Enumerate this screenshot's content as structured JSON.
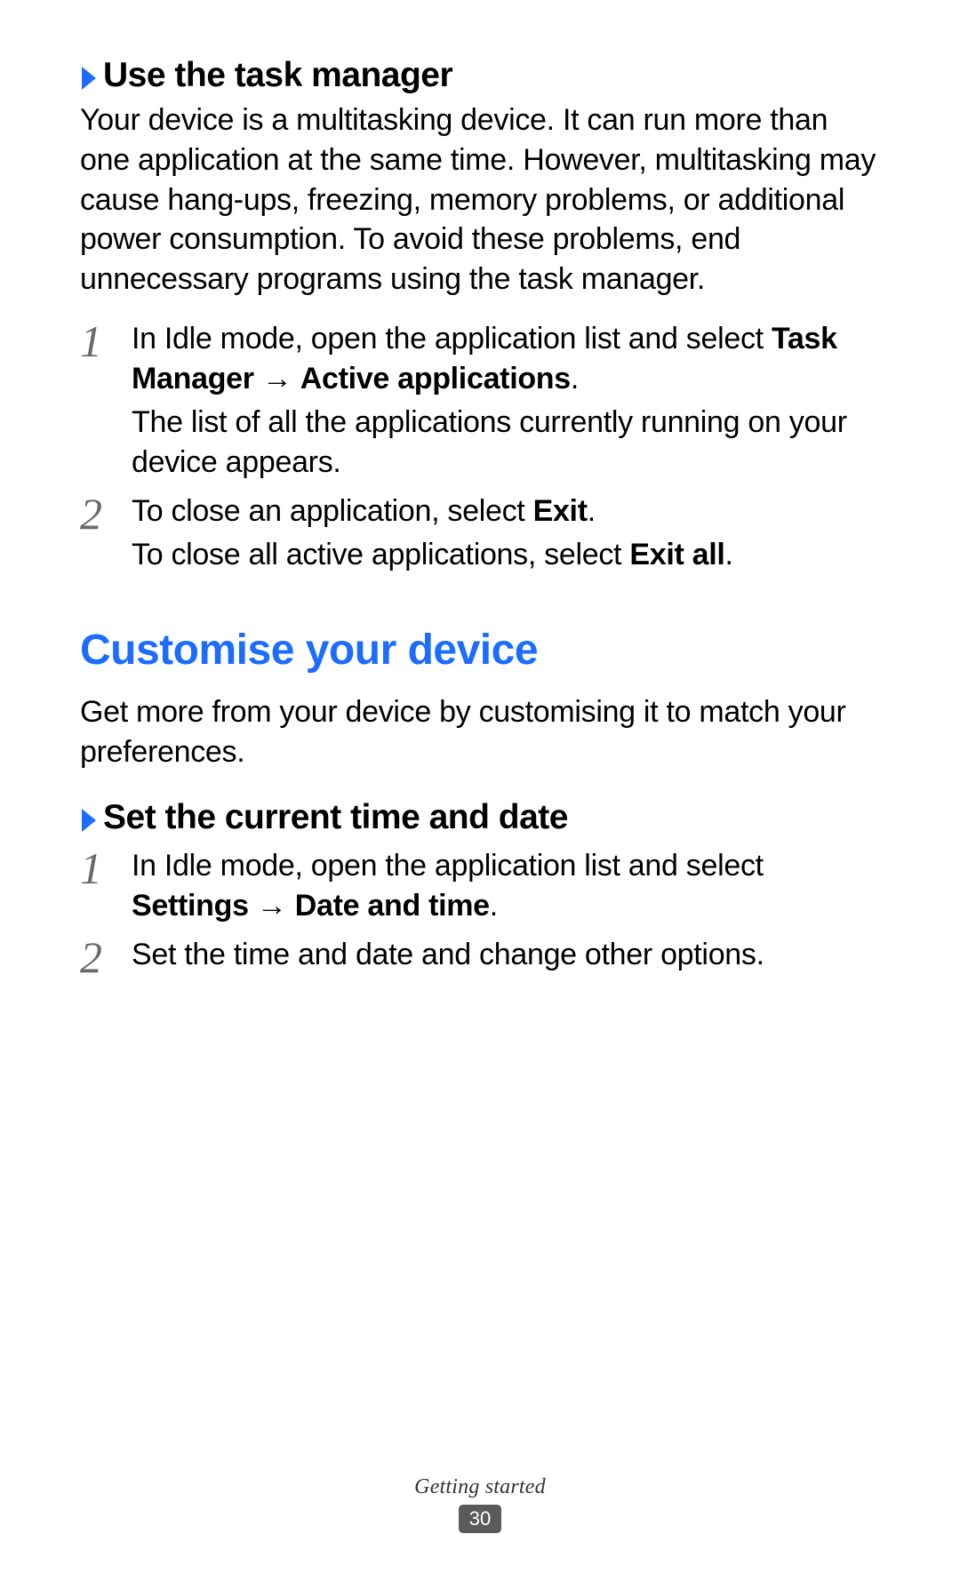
{
  "section1": {
    "heading": "Use the task manager",
    "intro": "Your device is a multitasking device. It can run more than one application at the same time. However, multitasking may cause hang-ups, freezing, memory problems, or additional power consumption. To avoid these problems, end unnecessary programs using the task manager.",
    "step1": {
      "num": "1",
      "pre": "In Idle mode, open the application list and select ",
      "b1": "Task Manager",
      "arrow": " → ",
      "b2": "Active applications",
      "post": ".",
      "line2": "The list of all the applications currently running on your device appears."
    },
    "step2": {
      "num": "2",
      "pre": "To close an application, select ",
      "b1": "Exit",
      "post1": ".",
      "line2pre": "To close all active applications, select ",
      "b2": "Exit all",
      "post2": "."
    }
  },
  "section2": {
    "title": "Customise your device",
    "intro": "Get more from your device by customising it to match your preferences.",
    "sub": {
      "heading": "Set the current time and date",
      "step1": {
        "num": "1",
        "pre": "In Idle mode, open the application list and select ",
        "b1": "Settings",
        "arrow": " → ",
        "b2": "Date and time",
        "post": "."
      },
      "step2": {
        "num": "2",
        "text": "Set the time and date and change other options."
      }
    }
  },
  "footer": {
    "label": "Getting started",
    "page": "30"
  }
}
